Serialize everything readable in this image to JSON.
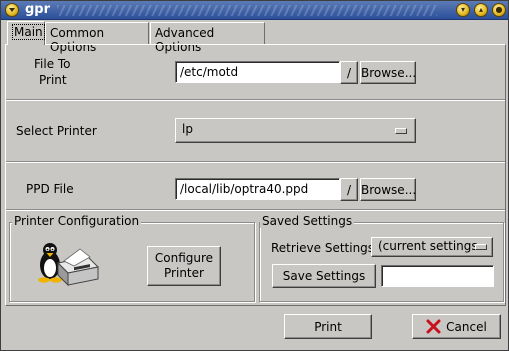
{
  "window": {
    "title": "gpr"
  },
  "tabs": [
    {
      "label": "Main",
      "active": true
    },
    {
      "label": "Common Options",
      "active": false
    },
    {
      "label": "Advanced Options",
      "active": false
    }
  ],
  "file_section": {
    "label_line1": "File To",
    "label_line2": "Print",
    "value": "/etc/motd",
    "slash_label": "/",
    "browse_label": "Browse..."
  },
  "printer_section": {
    "label": "Select Printer",
    "selected": "lp"
  },
  "ppd_section": {
    "label": "PPD File",
    "value": "/local/lib/optra40.ppd",
    "slash_label": "/",
    "browse_label": "Browse..."
  },
  "printer_config": {
    "title": "Printer Configuration",
    "button_line1": "Configure",
    "button_line2": "Printer",
    "icon": "tux-printer-icon"
  },
  "saved_settings": {
    "title": "Saved Settings",
    "retrieve_label": "Retrieve Settings",
    "retrieve_selected": "(current settings",
    "save_label": "Save Settings",
    "name_value": ""
  },
  "actions": {
    "print_label": "Print",
    "cancel_label": "Cancel"
  },
  "colors": {
    "background": "#c9c7c4",
    "titlebar": "#2b4f9a",
    "cancel_x": "#c8101a"
  }
}
